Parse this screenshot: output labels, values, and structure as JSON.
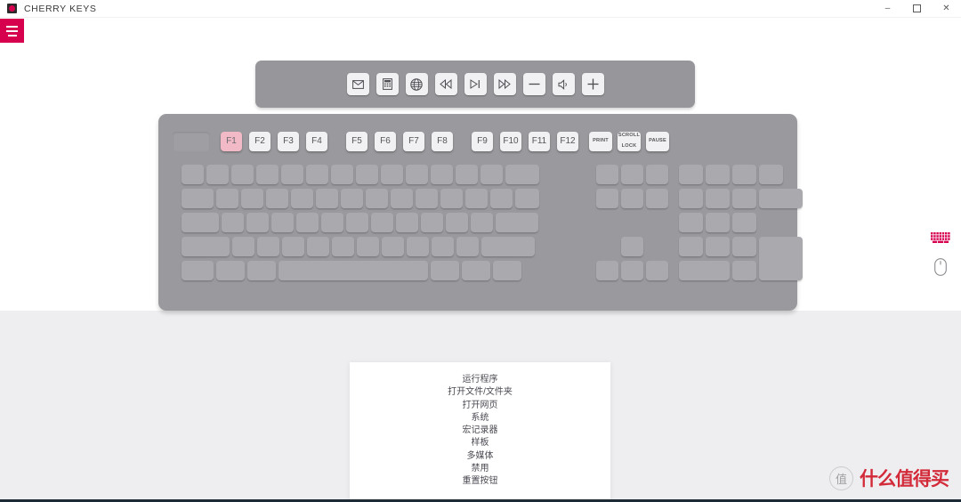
{
  "window": {
    "title": "CHERRY KEYS",
    "logo_icon": "cherry-logo-icon",
    "controls": {
      "minimize": "–",
      "maximize": "☐",
      "close": "✕"
    }
  },
  "menu_button": {
    "icon": "hamburger-icon",
    "label": ""
  },
  "media_bar": {
    "keys": [
      {
        "id": "mail",
        "icon": "mail-icon",
        "label": ""
      },
      {
        "id": "calculator",
        "icon": "calculator-icon",
        "label": ""
      },
      {
        "id": "browser",
        "icon": "globe-icon",
        "label": ""
      },
      {
        "id": "previous",
        "icon": "rewind-icon",
        "label": ""
      },
      {
        "id": "play-pause",
        "icon": "play-pause-icon",
        "label": ""
      },
      {
        "id": "next",
        "icon": "fast-forward-icon",
        "label": ""
      },
      {
        "id": "volume-down",
        "icon": "minus-icon",
        "label": ""
      },
      {
        "id": "mute",
        "icon": "speaker-mute-icon",
        "label": ""
      },
      {
        "id": "volume-up",
        "icon": "plus-icon",
        "label": ""
      }
    ]
  },
  "keyboard": {
    "function_row": [
      {
        "id": "esc",
        "label": "",
        "blank": true
      },
      {
        "id": "f1",
        "label": "F1",
        "active": true
      },
      {
        "id": "f2",
        "label": "F2"
      },
      {
        "id": "f3",
        "label": "F3"
      },
      {
        "id": "f4",
        "label": "F4"
      },
      {
        "id": "f5",
        "label": "F5"
      },
      {
        "id": "f6",
        "label": "F6"
      },
      {
        "id": "f7",
        "label": "F7"
      },
      {
        "id": "f8",
        "label": "F8"
      },
      {
        "id": "f9",
        "label": "F9"
      },
      {
        "id": "f10",
        "label": "F10"
      },
      {
        "id": "f11",
        "label": "F11"
      },
      {
        "id": "f12",
        "label": "F12"
      },
      {
        "id": "print",
        "label": "PRINT",
        "tiny": true
      },
      {
        "id": "scroll-lock",
        "label": "SCROLL\nLOCK",
        "tiny": true
      },
      {
        "id": "pause",
        "label": "PAUSE",
        "tiny": true
      }
    ]
  },
  "device_rail": {
    "keyboard_icon": "keyboard-icon",
    "mouse_icon": "mouse-icon",
    "active_color": "#d6004f",
    "inactive_color": "#8b8b90"
  },
  "action_menu": {
    "items": [
      {
        "id": "run-program",
        "label": "运行程序"
      },
      {
        "id": "open-file-folder",
        "label": "打开文件/文件夹"
      },
      {
        "id": "open-webpage",
        "label": "打开网页"
      },
      {
        "id": "system",
        "label": "系统"
      },
      {
        "id": "macro-recorder",
        "label": "宏记录器"
      },
      {
        "id": "template",
        "label": "样板"
      },
      {
        "id": "multimedia",
        "label": "多媒体"
      },
      {
        "id": "disable",
        "label": "禁用"
      },
      {
        "id": "reset-button",
        "label": "重置按钮"
      }
    ]
  },
  "watermark": {
    "badge": "值",
    "text": "什么值得买",
    "color": "#d11a2a"
  },
  "colors": {
    "accent": "#d6004f",
    "keyboard_body": "#9a9a9e",
    "keycap": "#aaaaae",
    "fn_keycap": "#f1f1f3",
    "fn_active": "#f2b9c6",
    "stage_bottom": "#eeeef0"
  }
}
